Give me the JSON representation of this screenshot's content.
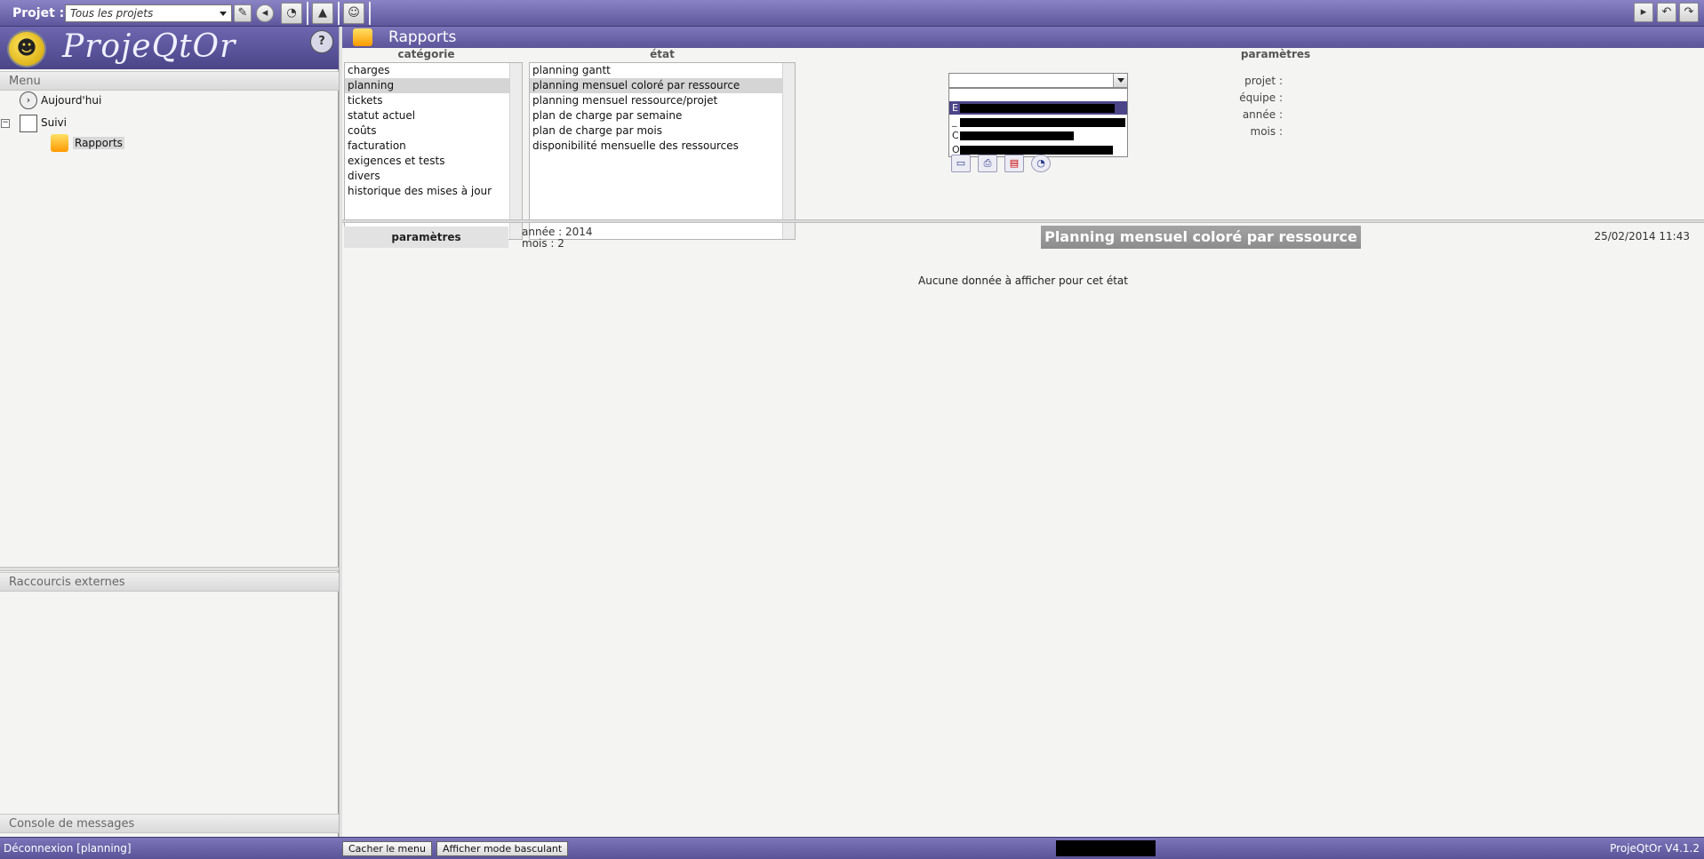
{
  "topbar": {
    "project_label": "Projet :",
    "project_value": "Tous les projets"
  },
  "left": {
    "app_title": "ProjeQtOr",
    "help_icon": "?",
    "menu_title": "Menu",
    "tree": [
      {
        "label": "Aujourd'hui"
      },
      {
        "label": "Suivi"
      },
      {
        "label": "Rapports"
      }
    ],
    "shortcuts_title": "Raccourcis externes",
    "console_title": "Console de messages"
  },
  "main": {
    "page_title": "Rapports",
    "category_title": "catégorie",
    "state_title": "état",
    "params_title": "paramètres",
    "categories": [
      "charges",
      "planning",
      "tickets",
      "statut actuel",
      "coûts",
      "facturation",
      "exigences et tests",
      "divers",
      "historique des mises à jour"
    ],
    "selected_category": "planning",
    "states": [
      "planning gantt",
      "planning mensuel coloré par ressource",
      "planning mensuel ressource/projet",
      "plan de charge par semaine",
      "plan de charge par mois",
      "disponibilité mensuelle des ressources"
    ],
    "selected_state": "planning mensuel coloré par ressource",
    "param_labels": {
      "projet": "projet :",
      "equipe": "équipe :",
      "annee": "année :",
      "mois": "mois :"
    },
    "dropdown_options": [
      "E",
      "_",
      "C",
      "O"
    ],
    "result": {
      "params_label": "paramètres",
      "year_line": "année : 2014",
      "month_line": "mois : 2",
      "title": "Planning mensuel coloré par ressource",
      "date": "25/02/2014 11:43",
      "no_data": "Aucune donnée à afficher pour cet état"
    }
  },
  "bottombar": {
    "logout": "Déconnexion [planning]",
    "hide_menu": "Cacher le menu",
    "toggle_mode": "Afficher mode basculant",
    "version": "ProjeQtOr V4.1.2"
  },
  "colors": {
    "accent": "#5f579e",
    "selected_row": "#d5d5d5",
    "title_bar": "#8c8c8c"
  }
}
